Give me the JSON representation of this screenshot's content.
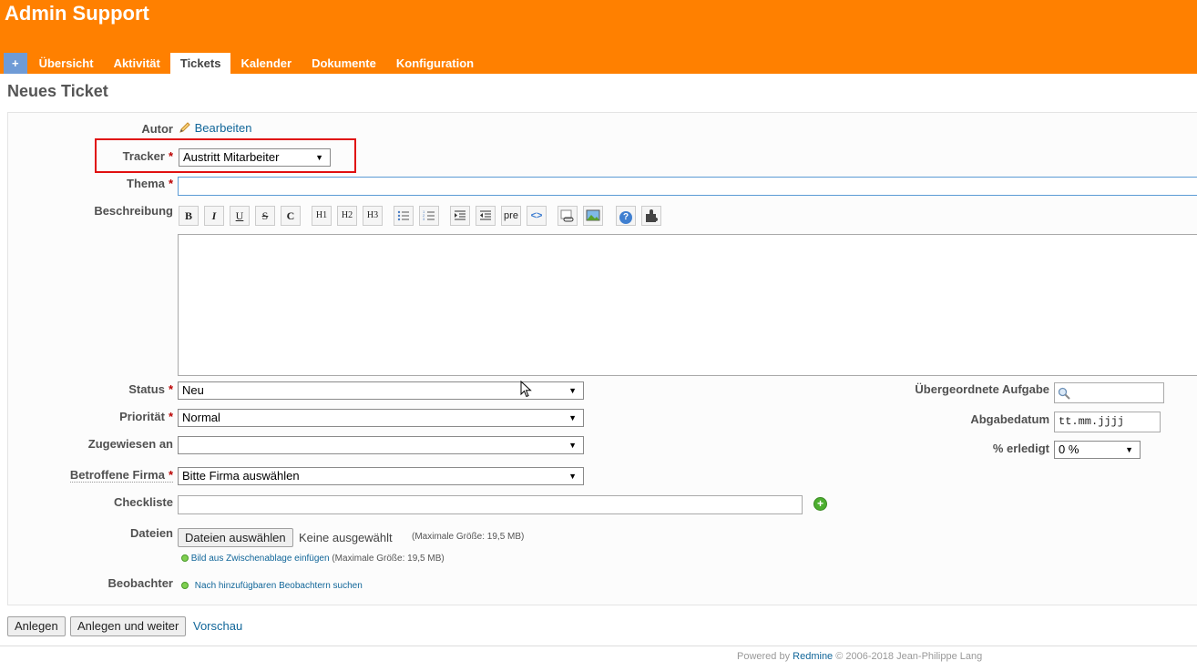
{
  "header": {
    "title": "Admin Support",
    "tabs": [
      {
        "label": "+"
      },
      {
        "label": "Übersicht"
      },
      {
        "label": "Aktivität"
      },
      {
        "label": "Tickets"
      },
      {
        "label": "Kalender"
      },
      {
        "label": "Dokumente"
      },
      {
        "label": "Konfiguration"
      }
    ],
    "selected_tab": "Tickets"
  },
  "page": {
    "title": "Neues Ticket"
  },
  "form": {
    "author": {
      "label": "Autor",
      "edit_link": "Bearbeiten"
    },
    "tracker": {
      "label": "Tracker",
      "value": "Austritt Mitarbeiter"
    },
    "subject": {
      "label": "Thema",
      "value": ""
    },
    "description": {
      "label": "Beschreibung",
      "toolbar": [
        "bold-icon",
        "italic-icon",
        "underline-icon",
        "strikethrough-icon",
        "code-icon",
        "h1-icon",
        "h2-icon",
        "h3-icon",
        "unordered-list-icon",
        "ordered-list-icon",
        "indent-icon",
        "outdent-icon",
        "preformatted-icon",
        "code-highlight-icon",
        "link-icon",
        "image-icon",
        "help-icon",
        "macro-icon"
      ],
      "toolbar_text": {
        "bold": "B",
        "italic": "I",
        "underline": "U",
        "strike": "S",
        "code": "C",
        "h1": "H1",
        "h2": "H2",
        "h3": "H3",
        "pre": "pre",
        "html": "<>",
        "help": "?"
      },
      "value": ""
    },
    "status": {
      "label": "Status",
      "value": "Neu"
    },
    "priority": {
      "label": "Priorität",
      "value": "Normal"
    },
    "assignee": {
      "label": "Zugewiesen an",
      "value": ""
    },
    "company": {
      "label": "Betroffene Firma",
      "value": "Bitte Firma auswählen"
    },
    "checklist": {
      "label": "Checkliste",
      "value": ""
    },
    "files": {
      "label": "Dateien",
      "choose_button": "Dateien auswählen",
      "no_file": "Keine ausgewählt",
      "max_size": "(Maximale Größe: 19,5 MB)",
      "clipboard_link": "Bild aus Zwischenablage einfügen",
      "clipboard_max_size": "(Maximale Größe: 19,5 MB)"
    },
    "watchers": {
      "label": "Beobachter",
      "search_link": "Nach hinzufügbaren Beobachtern suchen"
    },
    "parent_task": {
      "label": "Übergeordnete Aufgabe",
      "value": ""
    },
    "due_date": {
      "label": "Abgabedatum",
      "placeholder": "tt.mm.jjjj"
    },
    "done_ratio": {
      "label": "% erledigt",
      "value": "0 %"
    }
  },
  "actions": {
    "create": "Anlegen",
    "create_continue": "Anlegen und weiter",
    "preview": "Vorschau"
  },
  "footer": {
    "prefix": "Powered by",
    "app_link": "Redmine",
    "suffix": "© 2006-2018 Jean-Philippe Lang"
  },
  "colors": {
    "header": "#ff8000",
    "link": "#116699",
    "required": "#bb0000",
    "highlight": "#e01010"
  }
}
